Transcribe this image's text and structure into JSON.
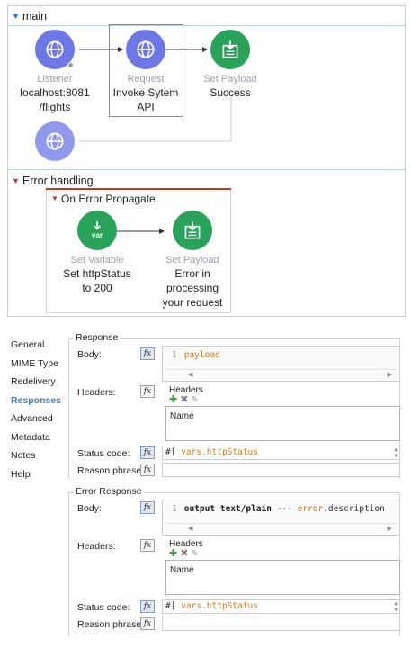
{
  "flow": {
    "main_title": "main",
    "nodes": [
      {
        "type": "Listener",
        "label_line1": "localhost:8081",
        "label_line2": "/flights"
      },
      {
        "type": "Request",
        "label_line1": "Invoke Sytem",
        "label_line2": "API"
      },
      {
        "type": "Set Payload",
        "label_line1": "Success",
        "label_line2": ""
      }
    ],
    "error_handling_title": "Error handling",
    "on_error_title": "On Error Propagate",
    "error_nodes": [
      {
        "type": "Set Variable",
        "label_line1": "Set httpStatus",
        "label_line2": "to 200",
        "label_line3": "",
        "icon_text": "var"
      },
      {
        "type": "Set Payload",
        "label_line1": "Error in",
        "label_line2": "processing",
        "label_line3": "your request"
      }
    ],
    "icons": {
      "http": "globe-icon",
      "set_payload": "payload-icon",
      "set_variable": "variable-icon"
    },
    "colors": {
      "http": "#6d78e6",
      "set": "#2aa35a",
      "error": "#c0392b",
      "selected": "#3fa0d8"
    }
  },
  "sidenav": {
    "items": [
      "General",
      "MIME Type",
      "Redelivery",
      "Responses",
      "Advanced",
      "Metadata",
      "Notes",
      "Help"
    ],
    "active": "Responses"
  },
  "response": {
    "legend": "Response",
    "body_label": "Body:",
    "body_line_no": "1",
    "body_code": "payload",
    "headers_label": "Headers:",
    "headers_title": "Headers",
    "headers_col": "Name",
    "status_label": "Status code:",
    "status_prefix": "#[",
    "status_expr": "vars.httpStatus",
    "reason_label": "Reason phrase:",
    "fx": "fx"
  },
  "error_response": {
    "legend": "Error Response",
    "body_label": "Body:",
    "body_line_no": "1",
    "body_code_kw": "output text/plain",
    "body_code_sep": " --- ",
    "body_code_var": "error",
    "body_code_rest": ".description",
    "headers_label": "Headers:",
    "headers_title": "Headers",
    "headers_col": "Name",
    "status_label": "Status code:",
    "status_prefix": "#[",
    "status_expr": "vars.httpStatus",
    "reason_label": "Reason phrase:",
    "fx": "fx"
  }
}
